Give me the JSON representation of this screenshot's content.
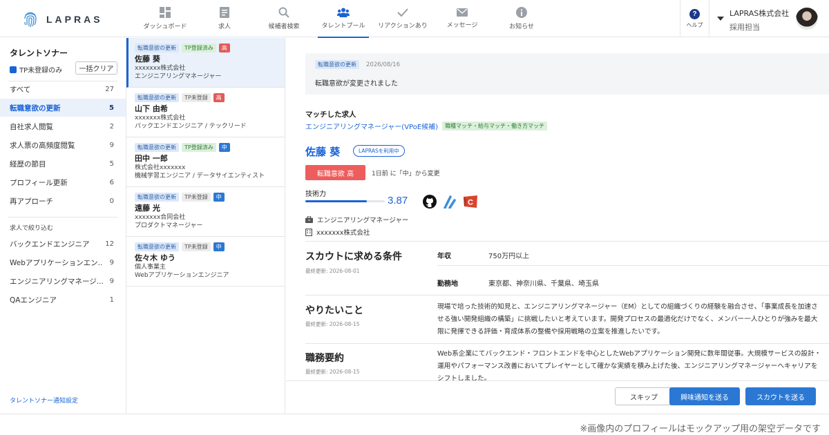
{
  "header": {
    "logo_text": "LAPRAS",
    "nav": [
      {
        "label": "ダッシュボード",
        "icon": "dashboard-icon"
      },
      {
        "label": "求人",
        "icon": "document-icon"
      },
      {
        "label": "候補者検索",
        "icon": "search-icon"
      },
      {
        "label": "タレントプール",
        "icon": "people-icon",
        "active": true
      },
      {
        "label": "リアクションあり",
        "icon": "check-icon"
      },
      {
        "label": "メッセージ",
        "icon": "mail-icon"
      },
      {
        "label": "お知らせ",
        "icon": "info-icon"
      }
    ],
    "help_label": "ヘルプ",
    "account_company": "LAPRAS株式会社",
    "account_role": "採用担当"
  },
  "sidebar": {
    "title": "タレントソナー",
    "tp_filter_label": "TP未登録のみ",
    "clear_label": "一括クリア",
    "items": [
      {
        "label": "すべて",
        "count": "27"
      },
      {
        "label": "転職意欲の更新",
        "count": "5",
        "active": true
      },
      {
        "label": "自社求人閲覧",
        "count": "2"
      },
      {
        "label": "求人票の高頻度閲覧",
        "count": "9"
      },
      {
        "label": "経歴の節目",
        "count": "5"
      },
      {
        "label": "プロフィール更新",
        "count": "6"
      },
      {
        "label": "再アプローチ",
        "count": "0"
      }
    ],
    "job_section_label": "求人で絞り込む",
    "job_items": [
      {
        "label": "バックエンドエンジニア",
        "count": "12"
      },
      {
        "label": "Webアプリケーションエン...",
        "count": "9"
      },
      {
        "label": "エンジニアリングマネージ...",
        "count": "9"
      },
      {
        "label": "QAエンジニア",
        "count": "1"
      }
    ],
    "footer_link": "タレントソナー通知設定"
  },
  "candidates": [
    {
      "tag1": "転職意欲の更新",
      "tag2": "TP登録済み",
      "tag2_style": "green",
      "tag3": "高",
      "tag3_style": "red",
      "name": "佐藤 葵",
      "company": "xxxxxxx株式会社",
      "role": "エンジニアリングマネージャー",
      "selected": true
    },
    {
      "tag1": "転職意欲の更新",
      "tag2": "TP未登録",
      "tag2_style": "gray",
      "tag3": "高",
      "tag3_style": "red",
      "name": "山下 由希",
      "company": "xxxxxxx株式会社",
      "role": "バックエンドエンジニア / テックリード"
    },
    {
      "tag1": "転職意欲の更新",
      "tag2": "TP登録済み",
      "tag2_style": "green",
      "tag3": "中",
      "tag3_style": "bluefill",
      "name": "田中 一郎",
      "company": "株式会社xxxxxxx",
      "role": "機械学習エンジニア / データサイエンティスト"
    },
    {
      "tag1": "転職意欲の更新",
      "tag2": "TP未登録",
      "tag2_style": "gray",
      "tag3": "中",
      "tag3_style": "bluefill",
      "name": "遠藤 光",
      "company": "xxxxxxx合同会社",
      "role": "プロダクトマネージャー"
    },
    {
      "tag1": "転職意欲の更新",
      "tag2": "TP未登録",
      "tag2_style": "gray",
      "tag3": "中",
      "tag3_style": "bluefill",
      "name": "佐々木 ゆう",
      "company": "個人事業主",
      "role": "Webアプリケーションエンジニア"
    }
  ],
  "detail": {
    "notice_tag": "転職意欲の更新",
    "notice_date": "2026/08/16",
    "notice_text": "転職意欲が変更されました",
    "match_title": "マッチした求人",
    "match_job": "エンジニアリングマネージャー(VPoE候補)",
    "match_tag": "職種マッチ・給与マッチ・働き方マッチ",
    "name": "佐藤 葵",
    "lapras_badge": "LAPRASを利用中",
    "intent_label": "転職意欲 高",
    "intent_change": "1日前 に「中」から変更",
    "skill_label": "技術力",
    "skill_score": "3.87",
    "skill_fraction": 0.77,
    "current_role": "エンジニアリングマネージャー",
    "current_company": "xxxxxxx株式会社",
    "scout": {
      "title": "スカウトに求める条件",
      "updated": "最終更新: 2026-08-01",
      "salary_label": "年収",
      "salary_value": "750万円以上",
      "location_label": "勤務地",
      "location_value": "東京都、神奈川県、千葉県、埼玉県"
    },
    "want": {
      "title": "やりたいこと",
      "updated": "最終更新: 2026-08-15",
      "body": "現場で培った技術的知見と、エンジニアリングマネージャー（EM）としての組織づくりの経験を融合させ、「事業成長を加速させる強い開発組織の構築」に挑戦したいと考えています。開発プロセスの最適化だけでなく、メンバー一人ひとりが強みを最大限に発揮できる評価・育成体系の整備や採用戦略の立案を推進したいです。"
    },
    "summary": {
      "title": "職務要約",
      "updated": "最終更新: 2026-08-15",
      "body": "Web系企業にてバックエンド・フロントエンドを中心としたWebアプリケーション開発に数年間従事。大規模サービスの設計・運用やパフォーマンス改善においてプレイヤーとして確かな実績を積み上げた後、エンジニアリングマネージャーへキャリアをシフトしました。"
    }
  },
  "actions": {
    "skip_label": "スキップ",
    "interest_label": "興味通知を送る",
    "scout_label": "スカウトを送る"
  },
  "footnote": "※画像内のプロフィールはモックアップ用の架空データです",
  "colors": {
    "accent": "#1a63d6",
    "danger": "#ee5d5d",
    "button": "#2b78d4"
  }
}
